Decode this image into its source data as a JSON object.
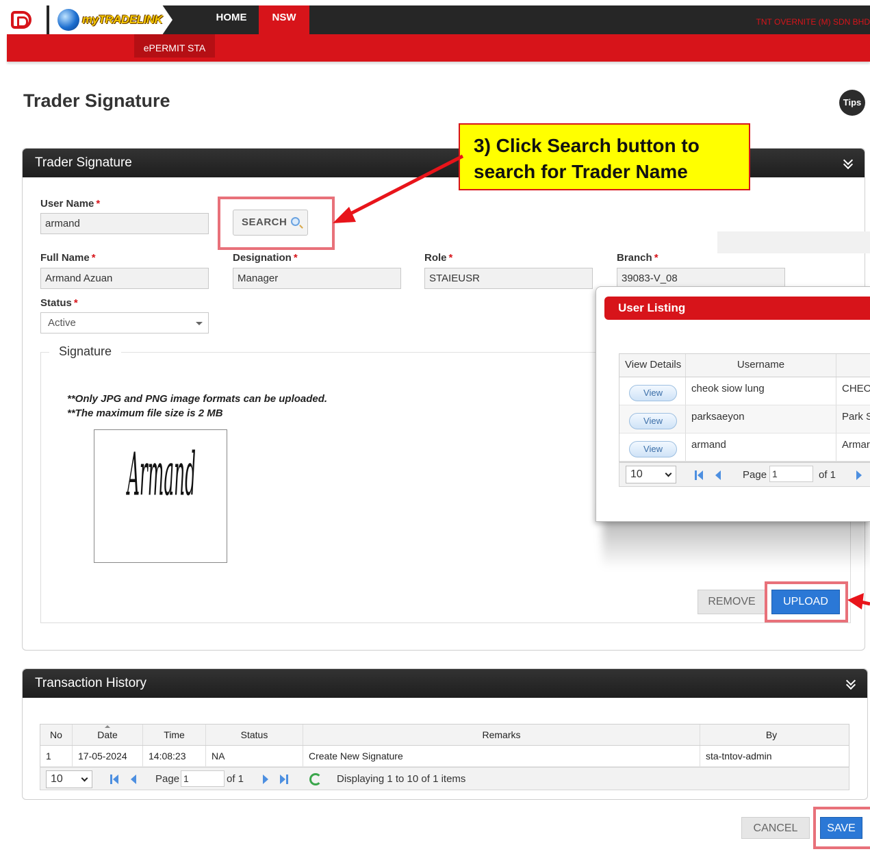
{
  "nav": {
    "brand": "myTRADELINK",
    "home": "HOME",
    "nsw": "NSW",
    "company": "TNT OVERNITE (M) SDN BHD",
    "sub_tab": "ePERMIT STA"
  },
  "page": {
    "title": "Trader Signature",
    "tips": "Tips"
  },
  "callout": {
    "line1": "3) Click Search button to",
    "line2": "search for Trader Name"
  },
  "form": {
    "panel_title": "Trader Signature",
    "user_name_label": "User Name",
    "user_name_value": "armand",
    "search_label": "SEARCH",
    "full_name_label": "Full Name",
    "full_name_value": "Armand Azuan",
    "designation_label": "Designation",
    "designation_value": "Manager",
    "role_label": "Role",
    "role_value": "STAIEUSR",
    "branch_label": "Branch",
    "branch_value": "39083-V_08",
    "status_label": "Status",
    "status_value": "Active",
    "required_mark": "*",
    "signature_legend": "Signature",
    "note1": "**Only JPG and PNG image formats can be uploaded.",
    "note2": "**The maximum file size is 2 MB",
    "signature_text": "Armand",
    "remove_label": "REMOVE",
    "upload_label": "UPLOAD"
  },
  "user_listing": {
    "title": "User Listing",
    "col_view": "View Details",
    "col_username": "Username",
    "view_label": "View",
    "rows": [
      {
        "username": "cheok siow lung",
        "name": "CHEO"
      },
      {
        "username": "parksaeyon",
        "name": "Park S"
      },
      {
        "username": "armand",
        "name": "Armar"
      }
    ],
    "page_size": "10",
    "page_label": "Page",
    "page_value": "1",
    "of_label": "of 1"
  },
  "history": {
    "panel_title": "Transaction History",
    "columns": [
      "No",
      "Date",
      "Time",
      "Status",
      "Remarks",
      "By"
    ],
    "rows": [
      {
        "no": "1",
        "date": "17-05-2024",
        "time": "14:08:23",
        "status": "NA",
        "remarks": "Create New Signature",
        "by": "sta-tntov-admin"
      }
    ],
    "page_size": "10",
    "page_label": "Page",
    "page_value": "1",
    "of_label": "of 1",
    "display_text": "Displaying 1 to 10 of 1 items"
  },
  "footer": {
    "cancel_label": "CANCEL",
    "save_label": "SAVE"
  },
  "colors": {
    "brand_red": "#d7141a",
    "header_dark": "#262626",
    "callout_yellow": "#ffff00",
    "highlight_pink": "#e8717a",
    "primary_blue": "#2b78d6"
  }
}
